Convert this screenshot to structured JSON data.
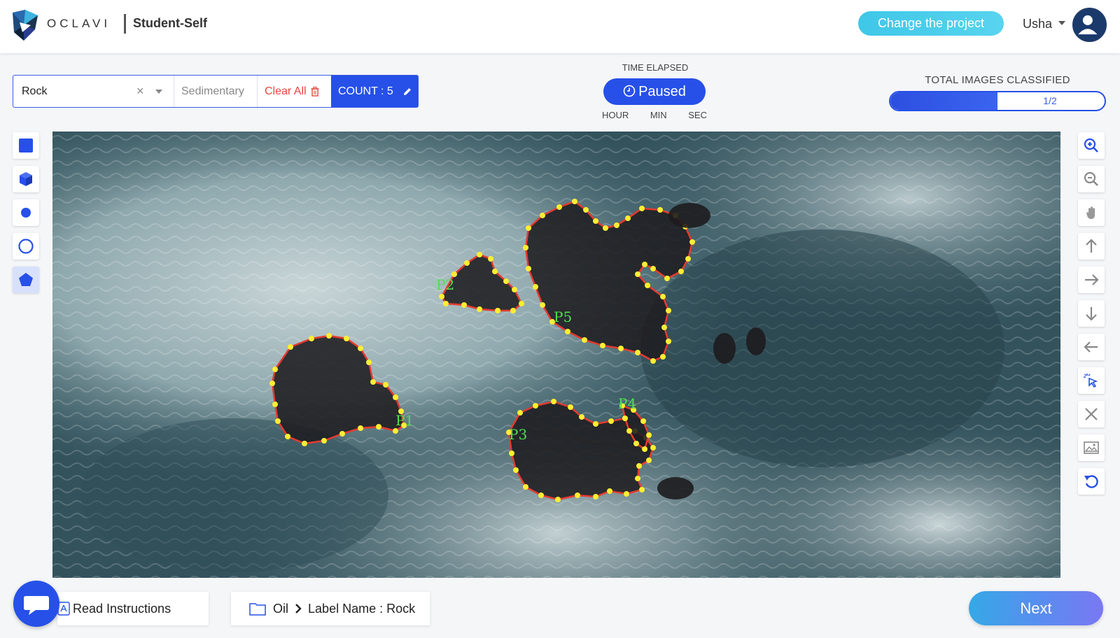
{
  "header": {
    "logo_text": "OCLAVI",
    "project_name": "Student-Self",
    "change_project_label": "Change the project",
    "user_name": "Usha"
  },
  "label_bar": {
    "selected_label": "Rock",
    "sub_label_placeholder": "Sedimentary",
    "clear_all_label": "Clear All",
    "count_label": "COUNT : 5"
  },
  "timer": {
    "title": "TIME ELAPSED",
    "status_label": "Paused",
    "units": [
      "HOUR",
      "MIN",
      "SEC"
    ]
  },
  "progress": {
    "title": "TOTAL IMAGES CLASSIFIED",
    "text": "1/2",
    "fraction": 0.5,
    "color": "#2650e8"
  },
  "left_tools": [
    {
      "name": "rectangle-tool",
      "icon": "square-icon"
    },
    {
      "name": "cuboid-tool",
      "icon": "cube-icon"
    },
    {
      "name": "point-tool",
      "icon": "dot-icon"
    },
    {
      "name": "circle-tool",
      "icon": "circle-icon"
    },
    {
      "name": "polygon-tool",
      "icon": "pentagon-icon",
      "active": true
    }
  ],
  "right_tools": [
    {
      "name": "zoom-in",
      "icon": "zoom-in-icon"
    },
    {
      "name": "zoom-out",
      "icon": "zoom-out-icon"
    },
    {
      "name": "pan",
      "icon": "hand-icon"
    },
    {
      "name": "move-up",
      "icon": "arrow-up-icon"
    },
    {
      "name": "move-right",
      "icon": "arrow-right-icon"
    },
    {
      "name": "move-down",
      "icon": "arrow-down-icon"
    },
    {
      "name": "move-left",
      "icon": "arrow-left-icon"
    },
    {
      "name": "select",
      "icon": "cursor-click-icon"
    },
    {
      "name": "clear",
      "icon": "close-icon"
    },
    {
      "name": "image",
      "icon": "image-icon"
    },
    {
      "name": "reset",
      "icon": "undo-icon"
    }
  ],
  "annotations": {
    "polygon_labels": [
      "P1",
      "P2",
      "P3",
      "P4",
      "P5"
    ],
    "stroke_color": "#e53a2f",
    "vertex_color": "#ffee33",
    "label_color": "#4fe04f"
  },
  "footer": {
    "read_instructions_label": "Read Instructions",
    "crumb_parent": "Oil",
    "crumb_label": "Label Name : Rock",
    "next_label": "Next"
  }
}
